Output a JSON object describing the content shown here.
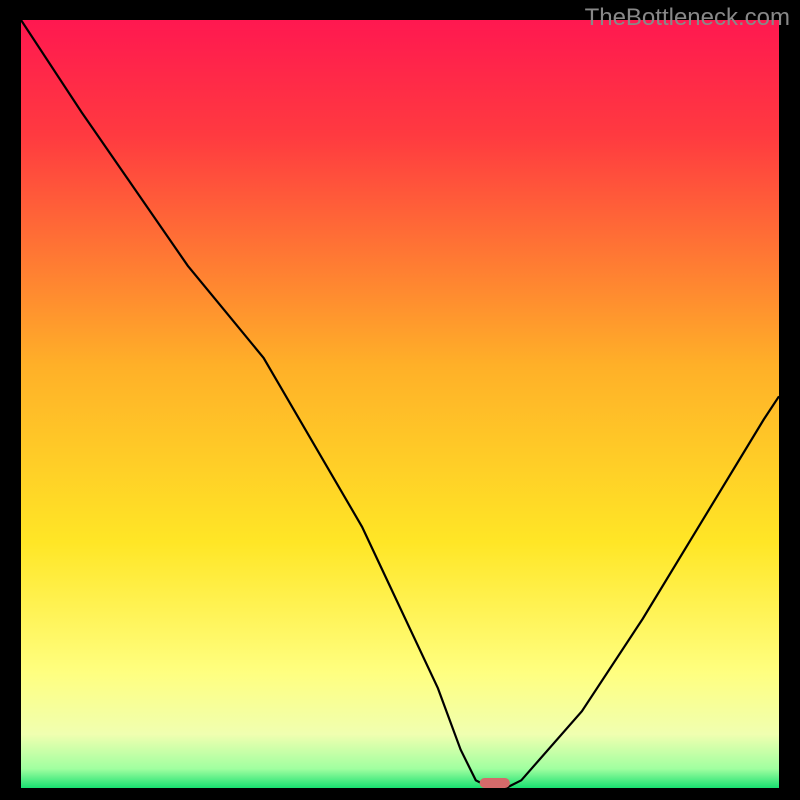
{
  "watermark": "TheBottleneck.com",
  "chart_data": {
    "type": "line",
    "title": "",
    "xlabel": "",
    "ylabel": "",
    "xlim": [
      0,
      100
    ],
    "ylim": [
      0,
      100
    ],
    "grid": false,
    "legend": false,
    "background_gradient": {
      "stops": [
        {
          "offset": 0,
          "color": "#ff1850"
        },
        {
          "offset": 0.15,
          "color": "#ff3a40"
        },
        {
          "offset": 0.45,
          "color": "#ffb028"
        },
        {
          "offset": 0.68,
          "color": "#ffe626"
        },
        {
          "offset": 0.85,
          "color": "#ffff80"
        },
        {
          "offset": 0.93,
          "color": "#f0ffb0"
        },
        {
          "offset": 0.975,
          "color": "#a0ffa0"
        },
        {
          "offset": 1,
          "color": "#18e070"
        }
      ]
    },
    "series": [
      {
        "name": "bottleneck-curve",
        "color": "#000000",
        "x": [
          0,
          8,
          15,
          22,
          27,
          32,
          45,
          55,
          58,
          60,
          62,
          64,
          66,
          74,
          82,
          90,
          98,
          100
        ],
        "y": [
          100,
          88,
          78,
          68,
          62,
          56,
          34,
          13,
          5,
          1,
          0,
          0,
          1,
          10,
          22,
          35,
          48,
          51
        ]
      }
    ],
    "marker": {
      "name": "optimal-point",
      "x": 62.5,
      "y": 0,
      "width": 4,
      "height": 1.3,
      "color": "#d46a6a"
    }
  }
}
